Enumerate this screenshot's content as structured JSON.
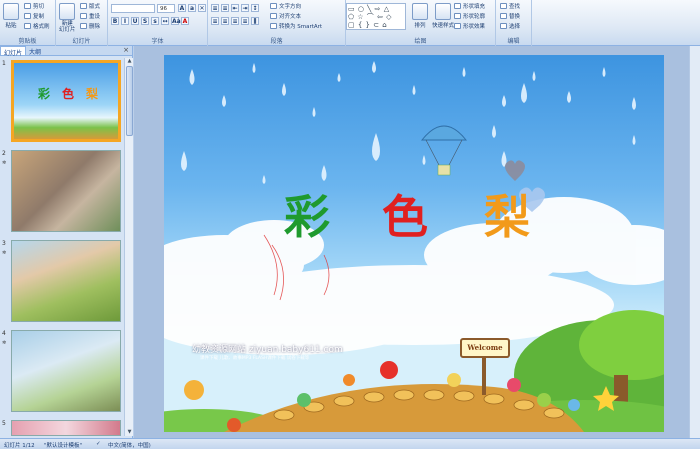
{
  "ribbon": {
    "clipboard": {
      "group_label": "剪贴板",
      "paste": "粘贴",
      "cut": "剪切",
      "copy": "复制",
      "format_painter": "格式刷"
    },
    "slides": {
      "group_label": "幻灯片",
      "new_slide": "新建\n幻灯片",
      "layout": "版式",
      "reset": "重设",
      "delete": "删除"
    },
    "font": {
      "group_label": "字体",
      "font_size": "96"
    },
    "paragraph": {
      "group_label": "段落",
      "text_direction": "文字方向",
      "align_text": "对齐文本",
      "convert_smartart": "转换为 SmartArt"
    },
    "drawing": {
      "group_label": "绘图",
      "arrange": "排列",
      "quick_styles": "快速样式",
      "shape_fill": "形状填充",
      "shape_outline": "形状轮廓",
      "shape_effects": "形状效果"
    },
    "editing": {
      "group_label": "编辑",
      "find": "查找",
      "replace": "替换",
      "select": "选择"
    }
  },
  "panel": {
    "tab_slides": "幻灯片",
    "tab_outline": "大纲",
    "close": "×",
    "thumbnails": [
      {
        "number": "1",
        "selected": true
      },
      {
        "number": "2",
        "selected": false
      },
      {
        "number": "3",
        "selected": false
      },
      {
        "number": "4",
        "selected": false
      },
      {
        "number": "5",
        "selected": false
      }
    ]
  },
  "slide": {
    "title_chars": [
      "彩",
      "色",
      "梨"
    ],
    "title_colors": [
      "#1f9a2e",
      "#e02020",
      "#f29a1a"
    ],
    "site_name": "幼教资源网站  ziyuan.baby611.com",
    "site_sub": "课件下载    儿歌、故事MP3    FLASH课件下载    试卷下载等",
    "sign_text": "Welcome"
  },
  "status": {
    "slide_info": "幻灯片 1/12",
    "theme": "\"默认设计模板\"",
    "language": "中文(简体，中国)"
  }
}
